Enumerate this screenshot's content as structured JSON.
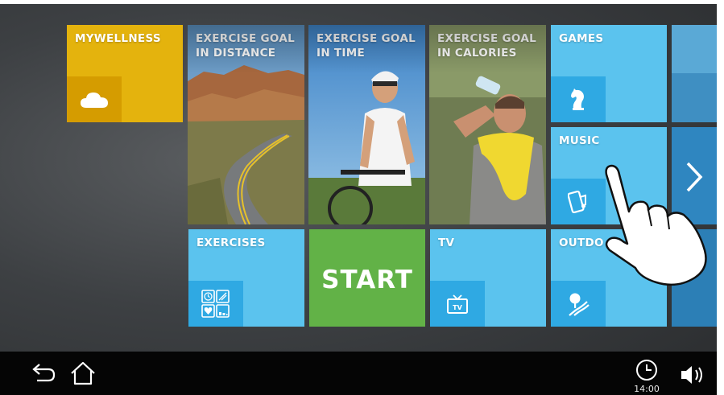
{
  "tiles": {
    "mywellness": {
      "title": "MYWELLNESS",
      "icon": "cloud-icon"
    },
    "goal_distance": {
      "title": "EXERCISE GOAL\nIN DISTANCE",
      "image": "winding-road-photo"
    },
    "goal_time": {
      "title": "EXERCISE GOAL\nIN TIME",
      "image": "cyclist-photo"
    },
    "goal_calories": {
      "title": "EXERCISE GOAL\nIN CALORIES",
      "image": "man-drinking-water-photo"
    },
    "games": {
      "title": "GAMES",
      "icon": "chess-knight-icon"
    },
    "music": {
      "title": "MUSIC",
      "icon": "phone-music-icon"
    },
    "exercises": {
      "title": "EXERCISES",
      "icon": "exercise-grid-icon"
    },
    "start": {
      "label": "START"
    },
    "tv": {
      "title": "TV",
      "icon": "tv-icon"
    },
    "outdoor": {
      "title": "OUTDO",
      "icon": "outdoor-path-icon"
    }
  },
  "nav": {
    "next_icon": "chevron-right-icon"
  },
  "bottom_bar": {
    "back_icon": "back-arrow-icon",
    "home_icon": "home-icon",
    "clock_icon": "clock-icon",
    "time": "14:00",
    "volume_icon": "volume-icon"
  },
  "colors": {
    "tile_blue": "#5bc3ee",
    "tile_blue_dark": "#2fa9e3",
    "tile_yellow": "#e4b30d",
    "tile_green": "#62b247",
    "bottom_bar": "#050505"
  }
}
